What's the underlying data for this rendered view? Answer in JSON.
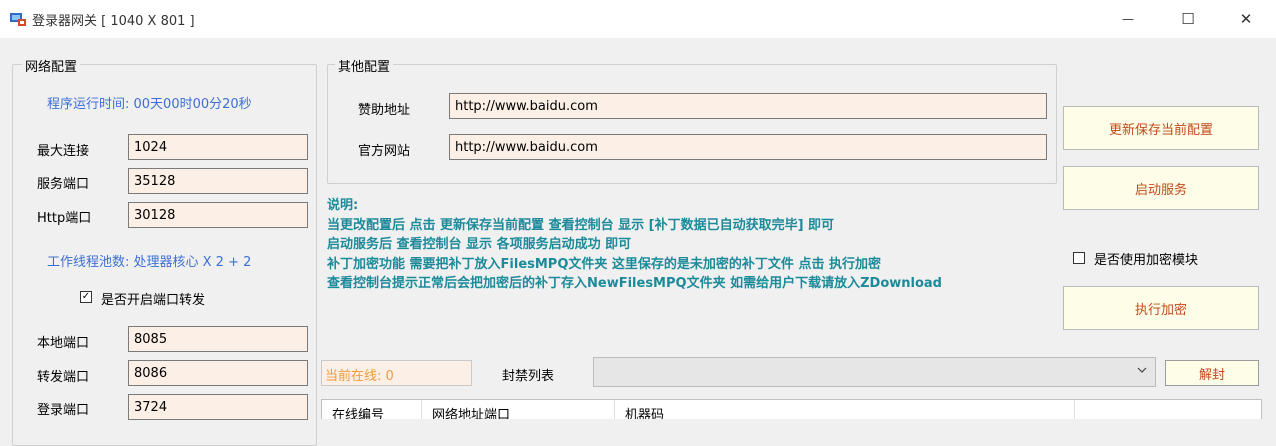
{
  "window": {
    "title": "登录器网关 [ 1040 X 801 ]",
    "minimize_glyph": "—",
    "maximize_glyph": "☐",
    "close_glyph": "✕"
  },
  "network": {
    "group_title": "网络配置",
    "runtime": "程序运行时间: 00天00时00分20秒",
    "max_conn_label": "最大连接",
    "max_conn": "1024",
    "service_port_label": "服务端口",
    "service_port": "35128",
    "http_port_label": "Http端口",
    "http_port": "30128",
    "thread_pool": "工作线程池数: 处理器核心 X 2 + 2",
    "forward_check_label": "是否开启端口转发",
    "forward_checked": true,
    "local_port_label": "本地端口",
    "local_port": "8085",
    "forward_port_label": "转发端口",
    "forward_port": "8086",
    "login_port_label": "登录端口",
    "login_port": "3724"
  },
  "other": {
    "group_title": "其他配置",
    "sponsor_label": "赞助地址",
    "sponsor_url": "http://www.baidu.com",
    "official_label": "官方网站",
    "official_url": "http://www.baidu.com"
  },
  "notes": {
    "title": "说明:",
    "lines": [
      "当更改配置后 点击 更新保存当前配置 查看控制台 显示 [补丁数据已自动获取完毕] 即可",
      "启动服务后 查看控制台 显示 各项服务启动成功 即可",
      "补丁加密功能 需要把补丁放入FilesMPQ文件夹 这里保存的是未加密的补丁文件 点击 执行加密",
      "查看控制台提示正常后会把加密后的补丁存入NewFilesMPQ文件夹 如需给用户下载请放入ZDownload"
    ]
  },
  "actions": {
    "save_config": "更新保存当前配置",
    "start_service": "启动服务",
    "use_encrypt_label": "是否使用加密模块",
    "use_encrypt_checked": false,
    "encrypt": "执行加密",
    "unban": "解封"
  },
  "bottom": {
    "online": "当前在线: 0",
    "ban_list_label": "封禁列表",
    "columns": [
      "在线编号",
      "网络地址端口",
      "机器码"
    ]
  },
  "colors": {
    "field_bg": "#fbefe6",
    "button_bg": "#fdfde8",
    "button_text": "#c34a1b",
    "blue_text": "#3c6fd6",
    "note_text": "#1d8a9a",
    "online_text": "#f29a3b"
  }
}
